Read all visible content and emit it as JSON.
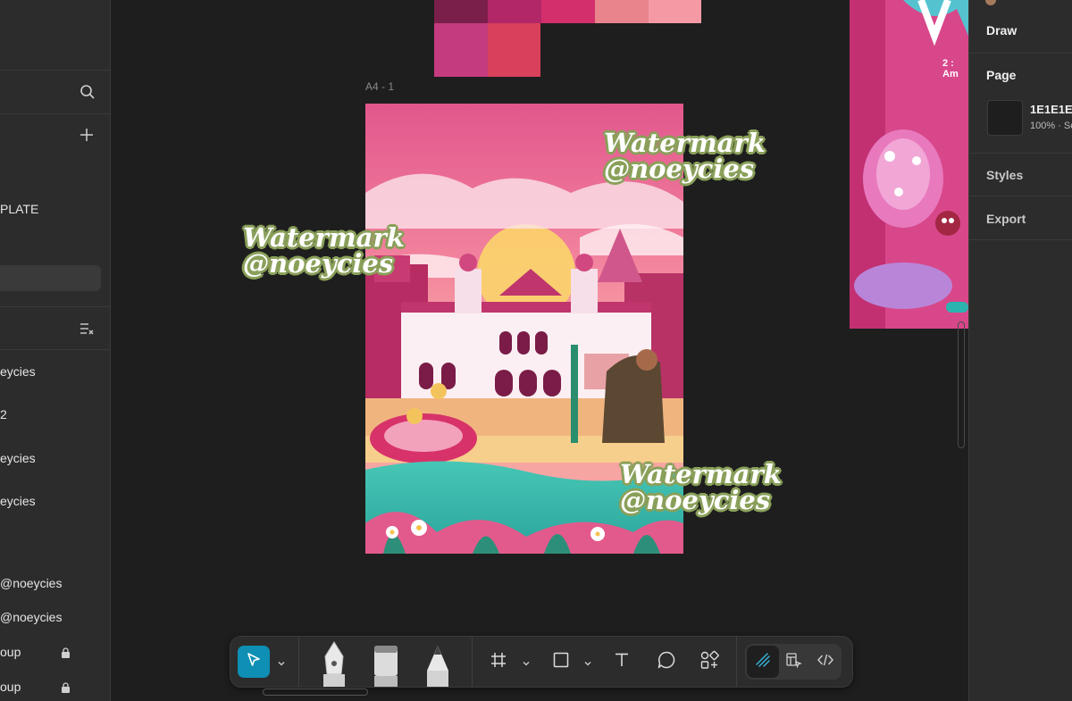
{
  "left_panel": {
    "items": {
      "template": "PLATE",
      "layer1": "eycies",
      "layer2": "2",
      "layer3": "eycies",
      "layer4": "eycies",
      "layer5": "@noeycies",
      "layer6": "@noeycies",
      "group1": "oup",
      "group2": "oup"
    },
    "icons": [
      "search-icon",
      "plus-icon",
      "sort-list-icon",
      "lock-icon"
    ]
  },
  "canvas": {
    "frame_label": "A4 - 1",
    "palette_colors": [
      "#7a1f4a",
      "#b22768",
      "#d42f6d",
      "#e9848c",
      "#f59aa5",
      "#c43b7f",
      "#d8405b"
    ],
    "watermarks": [
      {
        "line1": "Watermark",
        "line2": "@noeycies"
      },
      {
        "line1": "Watermark",
        "line2": "@noeycies"
      },
      {
        "line1": "Watermark",
        "line2": "@noeycies"
      }
    ],
    "side_poster_text": "2 : Am"
  },
  "right_panel": {
    "draw": "Draw",
    "page": "Page",
    "page_color": "1E1E1E",
    "page_opacity": "100% · Sc",
    "page_swatch": "#1e1e1e",
    "styles": "Styles",
    "export": "Export"
  },
  "toolbar": {
    "tools": [
      "move-tool",
      "pen-tool",
      "brush-tool",
      "pencil-tool",
      "frame-tool",
      "shape-tool",
      "text-tool",
      "comment-tool",
      "actions-tool",
      "draw-mode",
      "design-mode",
      "dev-mode"
    ],
    "accent": "#0e8fb3"
  }
}
